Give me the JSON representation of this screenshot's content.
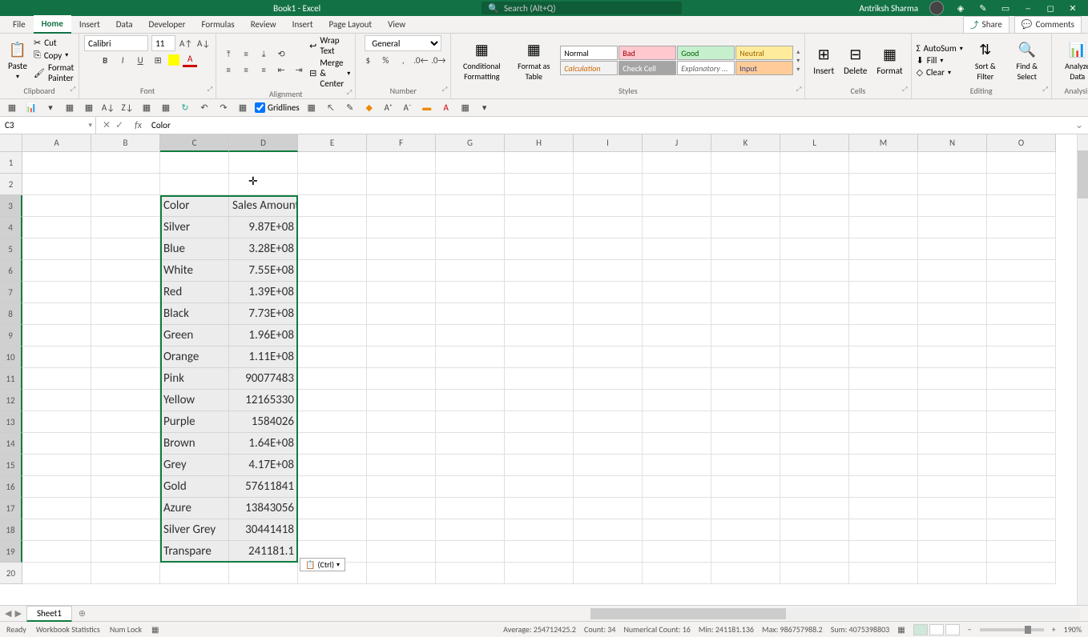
{
  "title": "Book1 - Excel",
  "search_placeholder": "Search (Alt+Q)",
  "user_name": "Antriksh Sharma",
  "tabs": [
    "File",
    "Home",
    "Insert",
    "Data",
    "Developer",
    "Formulas",
    "Review",
    "Insert",
    "Page Layout",
    "View"
  ],
  "ribbon_tabs": {
    "file": "File",
    "home": "Home",
    "insert": "Insert",
    "data": "Data",
    "developer": "Developer",
    "formulas": "Formulas",
    "review": "Review",
    "pagelayout": "Page Layout",
    "view": "View"
  },
  "share": "Share",
  "comments": "Comments",
  "clipboard": {
    "paste": "Paste",
    "cut": "Cut",
    "copy": "Copy",
    "format_painter": "Format Painter",
    "label": "Clipboard"
  },
  "font": {
    "name": "Calibri",
    "size": "11",
    "label": "Font"
  },
  "alignment": {
    "wrap": "Wrap Text",
    "merge": "Merge & Center",
    "label": "Alignment"
  },
  "number": {
    "format": "General",
    "label": "Number"
  },
  "styles": {
    "cond": "Conditional Formatting",
    "table": "Format as Table",
    "normal": "Normal",
    "bad": "Bad",
    "good": "Good",
    "neutral": "Neutral",
    "calc": "Calculation",
    "check": "Check Cell",
    "explan": "Explanatory ...",
    "input": "Input",
    "label": "Styles"
  },
  "cells": {
    "insert": "Insert",
    "delete": "Delete",
    "format": "Format",
    "label": "Cells"
  },
  "editing": {
    "autosum": "AutoSum",
    "fill": "Fill",
    "clear": "Clear",
    "sort": "Sort & Filter",
    "find": "Find & Select",
    "label": "Editing"
  },
  "analysis": {
    "analyze": "Analyze Data",
    "label": "Analysis"
  },
  "gridlines_label": "Gridlines",
  "name_box": "C3",
  "formula_value": "Color",
  "columns": [
    "A",
    "B",
    "C",
    "D",
    "E",
    "F",
    "G",
    "H",
    "I",
    "J",
    "K",
    "L",
    "M",
    "N",
    "O"
  ],
  "row_count": 20,
  "selected_cols": [
    2,
    3
  ],
  "selected_rows_start": 3,
  "selected_rows_end": 19,
  "sheet_data": {
    "headers": {
      "c": "Color",
      "d": "Sales Amount"
    },
    "rows": [
      {
        "c": "Silver",
        "d": "9.87E+08"
      },
      {
        "c": "Blue",
        "d": "3.28E+08"
      },
      {
        "c": "White",
        "d": "7.55E+08"
      },
      {
        "c": "Red",
        "d": "1.39E+08"
      },
      {
        "c": "Black",
        "d": "7.73E+08"
      },
      {
        "c": "Green",
        "d": "1.96E+08"
      },
      {
        "c": "Orange",
        "d": "1.11E+08"
      },
      {
        "c": "Pink",
        "d": "90077483"
      },
      {
        "c": "Yellow",
        "d": "12165330"
      },
      {
        "c": "Purple",
        "d": "1584026"
      },
      {
        "c": "Brown",
        "d": "1.64E+08"
      },
      {
        "c": "Grey",
        "d": "4.17E+08"
      },
      {
        "c": "Gold",
        "d": "57611841"
      },
      {
        "c": "Azure",
        "d": "13843056"
      },
      {
        "c": "Silver Grey",
        "d": "30441418"
      },
      {
        "c": "Transpare",
        "d": "241181.1"
      }
    ]
  },
  "paste_tag": "(Ctrl)",
  "sheet_name": "Sheet1",
  "status": {
    "ready": "Ready",
    "wb_stats": "Workbook Statistics",
    "numlock": "Num Lock",
    "average": "Average: 254712425.2",
    "count": "Count: 34",
    "numcount": "Numerical Count: 16",
    "min": "Min: 241181.136",
    "max": "Max: 986757988.2",
    "sum": "Sum: 4075398803",
    "zoom": "190%"
  }
}
